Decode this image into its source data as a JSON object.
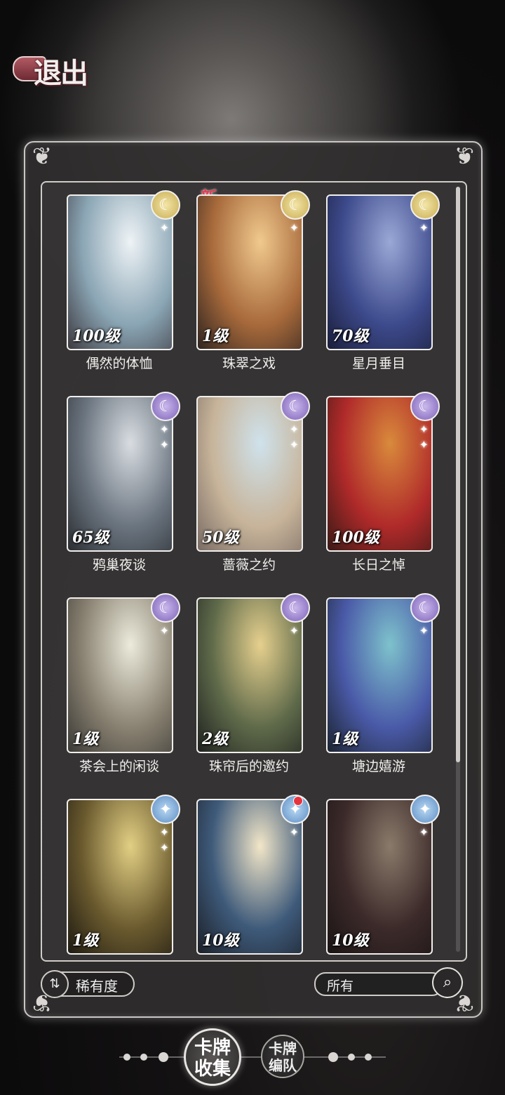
{
  "header": {
    "exit_label": "退出"
  },
  "badge_new": "新",
  "cards": [
    {
      "name": "偶然的体恤",
      "level": "100级",
      "rank": "gold",
      "colors": [
        "#eef3f6",
        "#8aa5b4",
        "#3d3a40"
      ],
      "sparkles": 1
    },
    {
      "name": "珠翠之戏",
      "level": "1级",
      "rank": "gold",
      "colors": [
        "#f0c98e",
        "#a86a3b",
        "#2f2420"
      ],
      "sparkles": 1
    },
    {
      "name": "星月垂目",
      "level": "70级",
      "rank": "gold",
      "colors": [
        "#9aa8d6",
        "#3d4a8c",
        "#1a1e3a"
      ],
      "sparkles": 1
    },
    {
      "name": "鸦巢夜谈",
      "level": "65级",
      "rank": "purple",
      "colors": [
        "#d9dde2",
        "#6b7580",
        "#2b2e32"
      ],
      "sparkles": 2
    },
    {
      "name": "蔷薇之约",
      "level": "50级",
      "rank": "purple",
      "colors": [
        "#cfe2ec",
        "#c7b49a",
        "#7a6c64"
      ],
      "sparkles": 2
    },
    {
      "name": "长日之悼",
      "level": "100级",
      "rank": "purple",
      "colors": [
        "#d98a3c",
        "#b02a2a",
        "#3a1a16"
      ],
      "sparkles": 2
    },
    {
      "name": "茶会上的闲谈",
      "level": "1级",
      "rank": "purple",
      "colors": [
        "#ecebdc",
        "#8a8272",
        "#3b3a36"
      ],
      "sparkles": 1
    },
    {
      "name": "珠帘后的邀约",
      "level": "2级",
      "rank": "purple",
      "colors": [
        "#e6d08e",
        "#5f6a4a",
        "#1f2220"
      ],
      "sparkles": 1
    },
    {
      "name": "塘边嬉游",
      "level": "1级",
      "rank": "purple",
      "colors": [
        "#7ec2cc",
        "#4a5aa8",
        "#1c2430"
      ],
      "sparkles": 1
    },
    {
      "name": "",
      "level": "1级",
      "rank": "blue",
      "colors": [
        "#e2cf84",
        "#6a5a2e",
        "#1e1a12"
      ],
      "sparkles": 2
    },
    {
      "name": "",
      "level": "10级",
      "rank": "blue",
      "colors": [
        "#f2e6c8",
        "#3e5a7a",
        "#1c2028"
      ],
      "sparkles": 1,
      "red_dot": true
    },
    {
      "name": "",
      "level": "10级",
      "rank": "blue",
      "colors": [
        "#8a7a6a",
        "#3c2a2a",
        "#1a1414"
      ],
      "sparkles": 1
    }
  ],
  "sort": {
    "label": "稀有度",
    "icon": "sort-icon"
  },
  "filter": {
    "label": "所有",
    "icon": "search-icon"
  },
  "nav": {
    "active": {
      "line1": "卡牌",
      "line2": "收集"
    },
    "inactive": {
      "line1": "卡牌",
      "line2": "编队"
    }
  }
}
